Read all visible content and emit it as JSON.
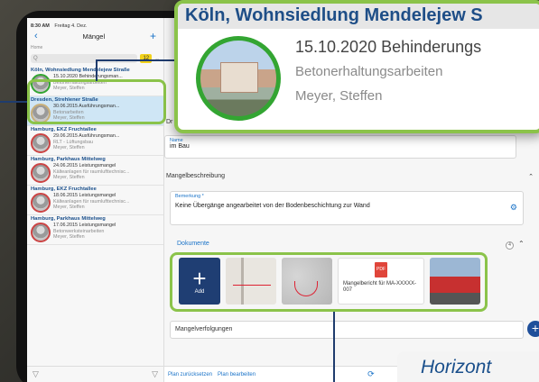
{
  "status": {
    "time": "8:30 AM",
    "date": "Freitag 4. Dez."
  },
  "sidebar": {
    "title": "Mängel",
    "back_icon": "chevron-left-icon",
    "add_icon": "plus-icon",
    "breadcrumb": "Home",
    "search_placeholder": "Q",
    "count": "12",
    "items": [
      {
        "head": "Köln, Wohnsiedlung Mendelejew Straße",
        "line1": "15.10.2020 Behinderungsman...",
        "line2": "Betonerhaltungsarbeiten",
        "line3": "Meyer, Steffen",
        "status_color": "#33a532"
      },
      {
        "head": "Dresden, Strehlener Straße",
        "line1": "30.06.2015 Ausführungsman...",
        "line2": "Betonarbeiten",
        "line3": "Meyer, Steffen",
        "status_color": "#c9b07a"
      },
      {
        "head": "Hamburg, EKZ Fruchtallee",
        "line1": "29.06.2015 Ausführungsman...",
        "line2": "RLT - Lüftungsbau",
        "line3": "Meyer, Steffen",
        "status_color": "#cc4444"
      },
      {
        "head": "Hamburg, Parkhaus Mittelweg",
        "line1": "24.06.2015 Leistungsmangel",
        "line2": "Kälteanlagen für raumlufttechnisc...",
        "line3": "Meyer, Steffen",
        "status_color": "#cc4444"
      },
      {
        "head": "Hamburg, EKZ Fruchtallee",
        "line1": "18.06.2015 Leistungsmangel",
        "line2": "Kälteanlagen für raumlufttechnisc...",
        "line3": "Meyer, Steffen",
        "status_color": "#cc4444"
      },
      {
        "head": "Hamburg, Parkhaus Mittelweg",
        "line1": "17.06.2015 Leistungsmangel",
        "line2": "Betonwerksteinarbeiten",
        "line3": "Meyer, Steffen",
        "status_color": "#cc4444"
      }
    ]
  },
  "main": {
    "status_field_label": "Name",
    "status_field_value": "im Bau",
    "section_description": "Mangelbeschreibung",
    "remark_label": "Bemerkung *",
    "remark_value": "Keine Übergänge angearbeitet von der Bodenbeschichtung zur Wand",
    "documents_label": "Dokumente",
    "documents_badge": "4",
    "add_label": "Add",
    "pdf_icon_text": "PDF",
    "pdf_name": "Mangelbericht für MA-XXXXX-007",
    "section_followups": "Mangelverfolgungen",
    "footer_reset": "Plan zurücksetzen",
    "footer_edit": "Plan bearbeiten",
    "partial_label": "Dr"
  },
  "zoom": {
    "title": "Köln, Wohnsiedlung Mendelejew S",
    "line1": "15.10.2020 Behinderungs",
    "line2": "Betonerhaltungsarbeiten",
    "line3": "Meyer, Steffen"
  },
  "callout": {
    "text": "Horizont"
  }
}
